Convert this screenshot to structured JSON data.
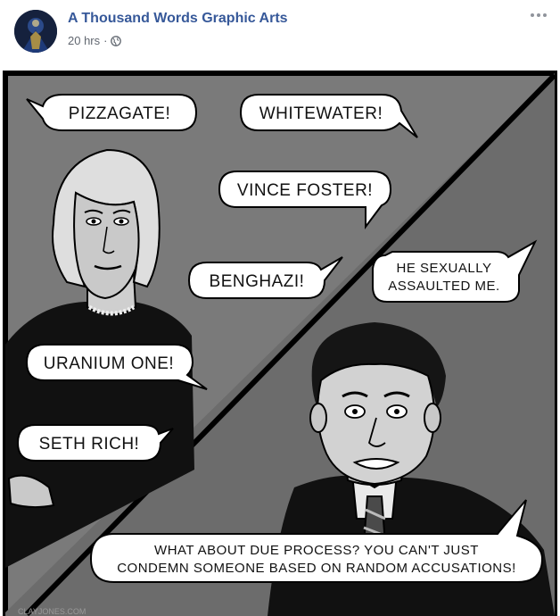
{
  "post": {
    "author": "A Thousand Words Graphic Arts",
    "time": "20 hrs",
    "separator": "·",
    "privacy_icon": "globe-icon",
    "more_icon": "more-options-icon"
  },
  "comic": {
    "bubbles": {
      "pizzagate": "PIZZAGATE!",
      "whitewater": "WHITEWATER!",
      "vince_foster": "VINCE FOSTER!",
      "benghazi": "BENGHAZI!",
      "assault_line1": "HE SEXUALLY",
      "assault_line2": "ASSAULTED ME.",
      "uranium": "URANIUM ONE!",
      "seth_rich": "SETH RICH!",
      "due_process_line1": "WHAT ABOUT DUE PROCESS? YOU CAN'T JUST",
      "due_process_line2": "CONDEMN SOMEONE BASED ON RANDOM ACCUSATIONS!"
    },
    "credit": "CLAYJONES.COM"
  },
  "colors": {
    "link": "#365899",
    "meta": "#616770",
    "panel_gray": "#7a7a7a",
    "panel_dark": "#5e5e5e"
  }
}
